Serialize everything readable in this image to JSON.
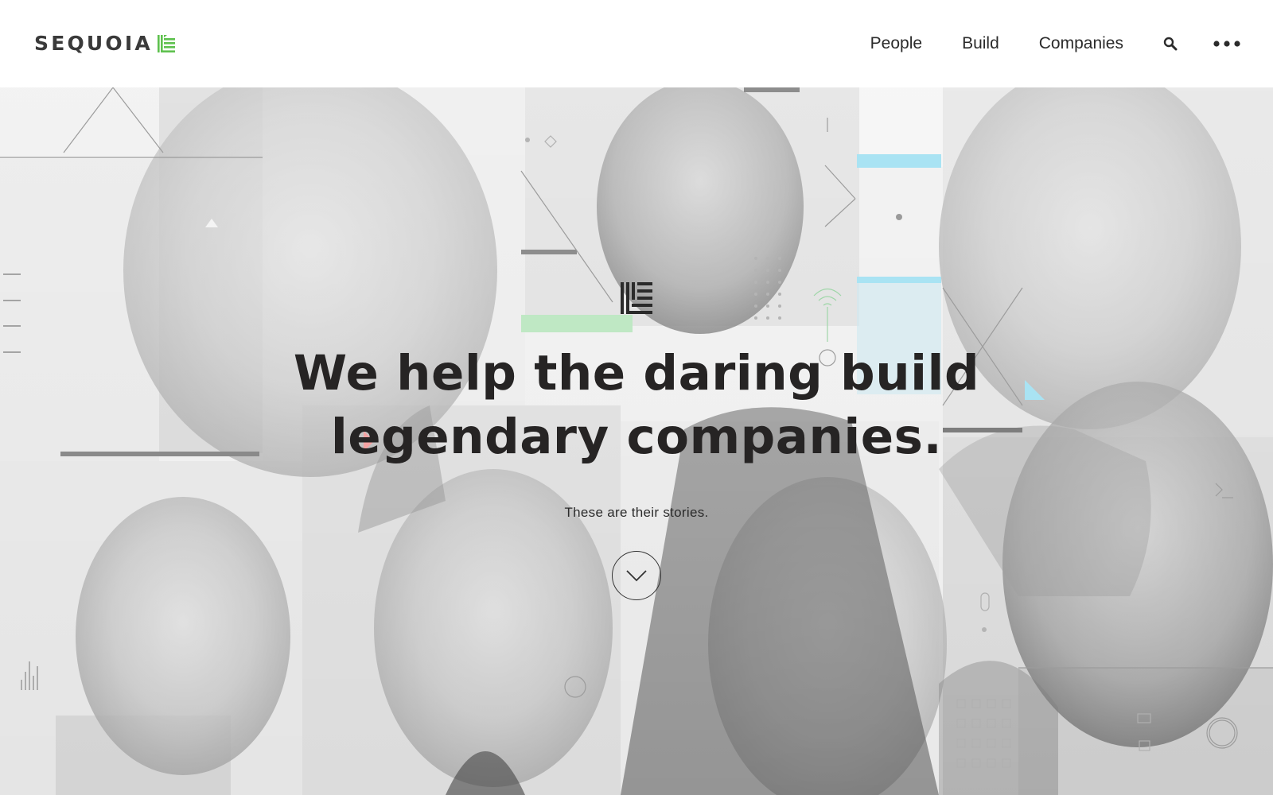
{
  "header": {
    "logo_text": "SEQUOIA",
    "nav": {
      "people": "People",
      "build": "Build",
      "companies": "Companies"
    },
    "icons": [
      "search-icon",
      "more-menu-icon"
    ]
  },
  "hero": {
    "headline_line1": "We help the daring build",
    "headline_line2": "legendary companies.",
    "subtitle": "These are their stories.",
    "scroll_icon": "chevron-down-icon"
  },
  "colors": {
    "brand_green": "#5ec14e",
    "text_dark": "#262424",
    "accent_blue": "#a9e3f3",
    "accent_mint": "#bfe8c4",
    "accent_red": "#f4a3a3"
  }
}
